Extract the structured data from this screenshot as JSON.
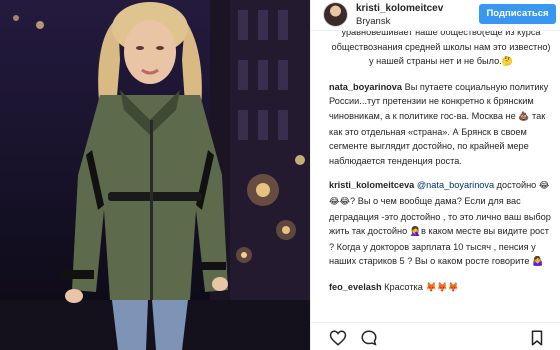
{
  "post": {
    "username": "kristi_kolomeitcev",
    "location": "Bryansk",
    "follow_label": "Подписаться"
  },
  "comments": [
    {
      "user": "",
      "text": "уравновешивает наше общество(еще из курса обществознания средней школы нам это известно) у нашей страны нет и не было.",
      "emoji": "🤔"
    },
    {
      "user": "nata_boyarinova",
      "text1": " Вы путаете социальную политику России...тут претензии не конкретно к брянским чиновникам, а к политике гос-ва. Москва не ",
      "emoji": "💩",
      "text2": " так как это отдельная «страна». А Брянск в своем сегменте выглядит достойно, по крайней мере наблюдается тенденция роста."
    },
    {
      "user": "kristi_kolomeitceva",
      "mention": "@nata_boyarinova",
      "t1": " достойно ",
      "e1": "😂😂😂",
      "t2": "? Вы о чем вообще дама? Если для вас деградация -это достойно , то это лично ваш выбор жить так достойно ",
      "e2": "🤦‍♀️",
      "t3": "в каком месте вы видите рост ? Когда у докторов зарплата 10 тысяч , пенсия у наших стариков 5 ? Вы о каком росте говорите ",
      "e3": "🤷‍♀️"
    },
    {
      "user": "feo_evelash",
      "text": "  Красотка",
      "emoji": "🦊🦊🦊"
    }
  ],
  "icons": {
    "like": "heart-icon",
    "comment": "comment-icon",
    "bookmark": "bookmark-icon"
  },
  "colors": {
    "follow_button": "#3897f0",
    "text": "#262626",
    "mention": "#003569"
  }
}
